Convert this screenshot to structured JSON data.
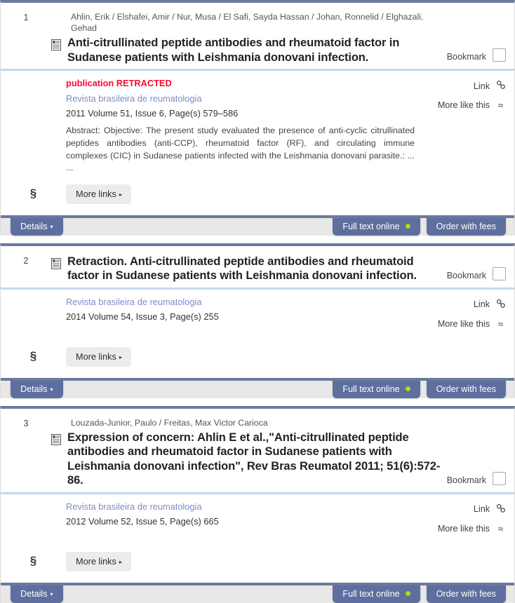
{
  "labels": {
    "bookmark": "Bookmark",
    "link": "Link",
    "more_like_this": "More like this",
    "more_links": "More links",
    "details": "Details",
    "full_text_online": "Full text online",
    "order_with_fees": "Order with fees",
    "caret": "▾",
    "caret_right": "▸",
    "link_icon_glyph": "⚗",
    "more_like_this_glyph": "≈",
    "caduceus_glyph": "§"
  },
  "colors": {
    "card_top_border": "#6a7aa0",
    "header_divider": "#c5d8f0",
    "retracted_red": "#fb0a32",
    "journal_link_blue": "#7f8bc9",
    "button_blue": "#5e6e9e",
    "footer_bg": "#e8e8e8",
    "status_dot_green": "#b4d911"
  },
  "records": [
    {
      "number": "1",
      "authors": "Ahlin, Erik / Elshafei, Amir / Nur, Musa / El Safi, Sayda Hassan / Johan, Ronnelid / Elghazali, Gehad",
      "title": "Anti-citrullinated peptide antibodies and rheumatoid factor in Sudanese patients with Leishmania donovani infection.",
      "status_note": "publication RETRACTED",
      "journal": "Revista brasileira de reumatologia",
      "pub_meta": "2011  Volume 51, Issue 6, Page(s) 579–586",
      "abstract": "Abstract: Objective: The present study evaluated the presence of anti-cyclic citrullinated peptides antibodies (anti-CCP), rheumatoid factor (RF), and circulating immune complexes (CIC) in Sudanese patients infected with the Leishmania donovani parasite.: ... ..."
    },
    {
      "number": "2",
      "authors": "",
      "title": "Retraction. Anti-citrullinated peptide antibodies and rheumatoid factor in Sudanese patients with Leishmania donovani infection.",
      "status_note": "",
      "journal": "Revista brasileira de reumatologia",
      "pub_meta": "2014  Volume 54, Issue 3, Page(s) 255",
      "abstract": ""
    },
    {
      "number": "3",
      "authors": "Louzada-Junior, Paulo / Freitas, Max Victor Carioca",
      "title": "Expression of concern: Ahlin E et al.,\"Anti-citrullinated peptide antibodies and rheumatoid factor in Sudanese patients with Leishmania donovani infection\", Rev Bras Reumatol 2011; 51(6):572-86.",
      "status_note": "",
      "journal": "Revista brasileira de reumatologia",
      "pub_meta": "2012  Volume 52, Issue 5, Page(s) 665",
      "abstract": ""
    }
  ]
}
